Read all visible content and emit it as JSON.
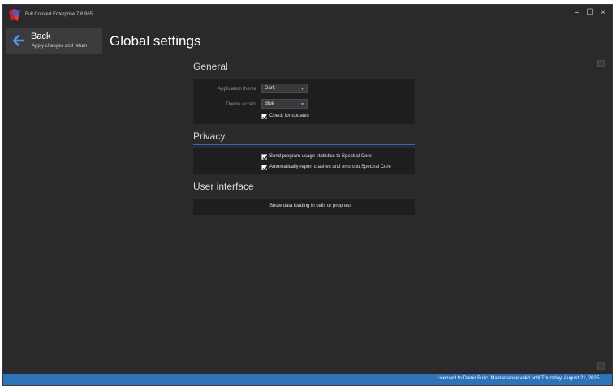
{
  "window": {
    "title": "Full Convert Enterprise 7.6.965",
    "controls": {
      "minimize": "–",
      "maximize": "☐",
      "close": "×"
    }
  },
  "nav": {
    "back_label": "Back",
    "back_sublabel": "Apply changes and return"
  },
  "page": {
    "title": "Global settings"
  },
  "sections": {
    "general": {
      "title": "General",
      "app_theme_label": "Application theme",
      "app_theme_value": "Dark",
      "theme_accent_label": "Theme accent",
      "theme_accent_value": "Blue",
      "check_updates_label": "Check for updates",
      "check_updates_checked": true
    },
    "privacy": {
      "title": "Privacy",
      "usage_stats_label": "Send program usage statistics to Spectral Core",
      "usage_stats_checked": true,
      "crash_reports_label": "Automatically report crashes and errors to Spectral Core",
      "crash_reports_checked": true
    },
    "user_interface": {
      "title": "User interface",
      "data_loading_label": "Show data loading in cells or progress",
      "data_loading_checked": false
    }
  },
  "status": {
    "text": "Licensed to Damir Bulic. Maintenance valid until Thursday, August 21, 2025."
  },
  "colors": {
    "accent": "#2e72b8",
    "window_bg": "#2a2a2c",
    "panel_bg": "#1e1e20"
  }
}
